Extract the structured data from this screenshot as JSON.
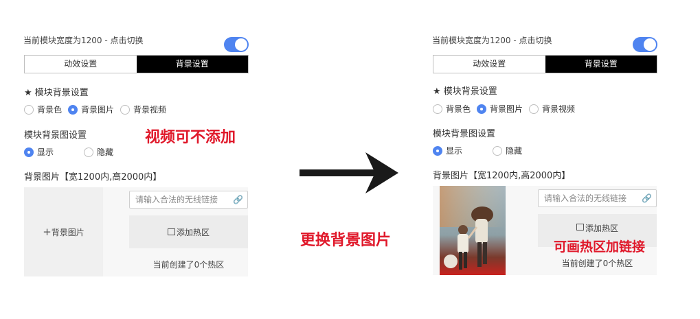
{
  "panel": {
    "width_label": "当前模块宽度为1200 - 点击切换",
    "tabs": [
      "动效设置",
      "背景设置"
    ],
    "bg_section_title": "★ 模块背景设置",
    "bg_options": [
      "背景色",
      "背景图片",
      "背景视频"
    ],
    "bg_selected": "背景图片",
    "img_section_title": "模块背景图设置",
    "visibility_options": [
      "显示",
      "隐藏"
    ],
    "visibility_selected": "显示",
    "image_label": "背景图片【宽1200内,高2000内】",
    "upload_label": "背景图片",
    "upload_plus": "+",
    "link_placeholder": "请输入合法的无线链接",
    "add_hotspot_label": "添加热区",
    "hotspot_count_text": "当前创建了0个热区"
  },
  "annotations": {
    "video_note": "视频可不添加",
    "replace_note": "更换背景图片",
    "hotspot_note": "可画热区加链接"
  },
  "colors": {
    "accent": "#4f84f0",
    "annotation": "#e0182a",
    "active_tab": "#000000"
  }
}
